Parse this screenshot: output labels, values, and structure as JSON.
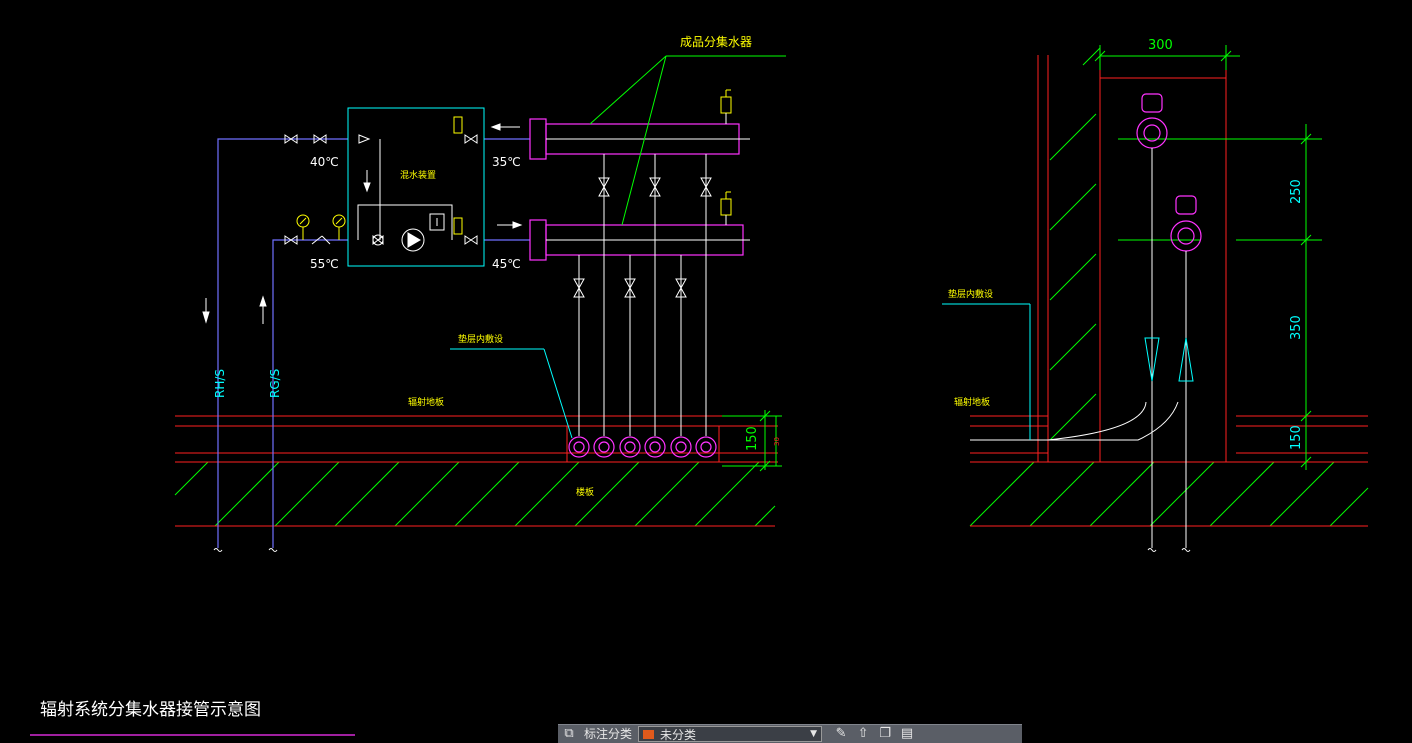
{
  "colors": {
    "background": "#000000",
    "supply_return_pipe": "#7070ff",
    "cabinet_and_manifold": "#ff33ff",
    "valves_and_fittings": "#ffffff",
    "floor_structure": "#ff2020",
    "hatch_and_dimensions": "#00ff00",
    "labels": "#00ffff",
    "yellow_symbols": "#ffff00"
  },
  "drawing": {
    "title": "辐射系统分集水器接管示意图",
    "manifold_label": "成品分集水器",
    "mixing_unit_label": "混水装置",
    "temp_supply_in": "55℃",
    "temp_return_out": "40℃",
    "temp_return_in": "35℃",
    "temp_supply_out": "45℃",
    "return_pipe_label": "RH/S",
    "supply_pipe_label": "RG/S",
    "cushion_layer_label": "垫层内敷设",
    "radiant_floor_label": "辐射地板",
    "floor_slab_label": "楼板",
    "dim_150": "150",
    "dim_small": "30",
    "section_cushion_label": "垫层内敷设",
    "section_radiant_label": "辐射地板",
    "dim_width": "300",
    "dim_250": "250",
    "dim_350": "350",
    "dim_150b": "150"
  },
  "toolbar": {
    "icons": [
      "layers-icon",
      "pen-icon",
      "arrow-up-icon",
      "copy-icon",
      "save-icon"
    ],
    "layer_label": "标注分类",
    "selected_layer": "未分类",
    "selected_layer_color": "#e05a1c"
  }
}
